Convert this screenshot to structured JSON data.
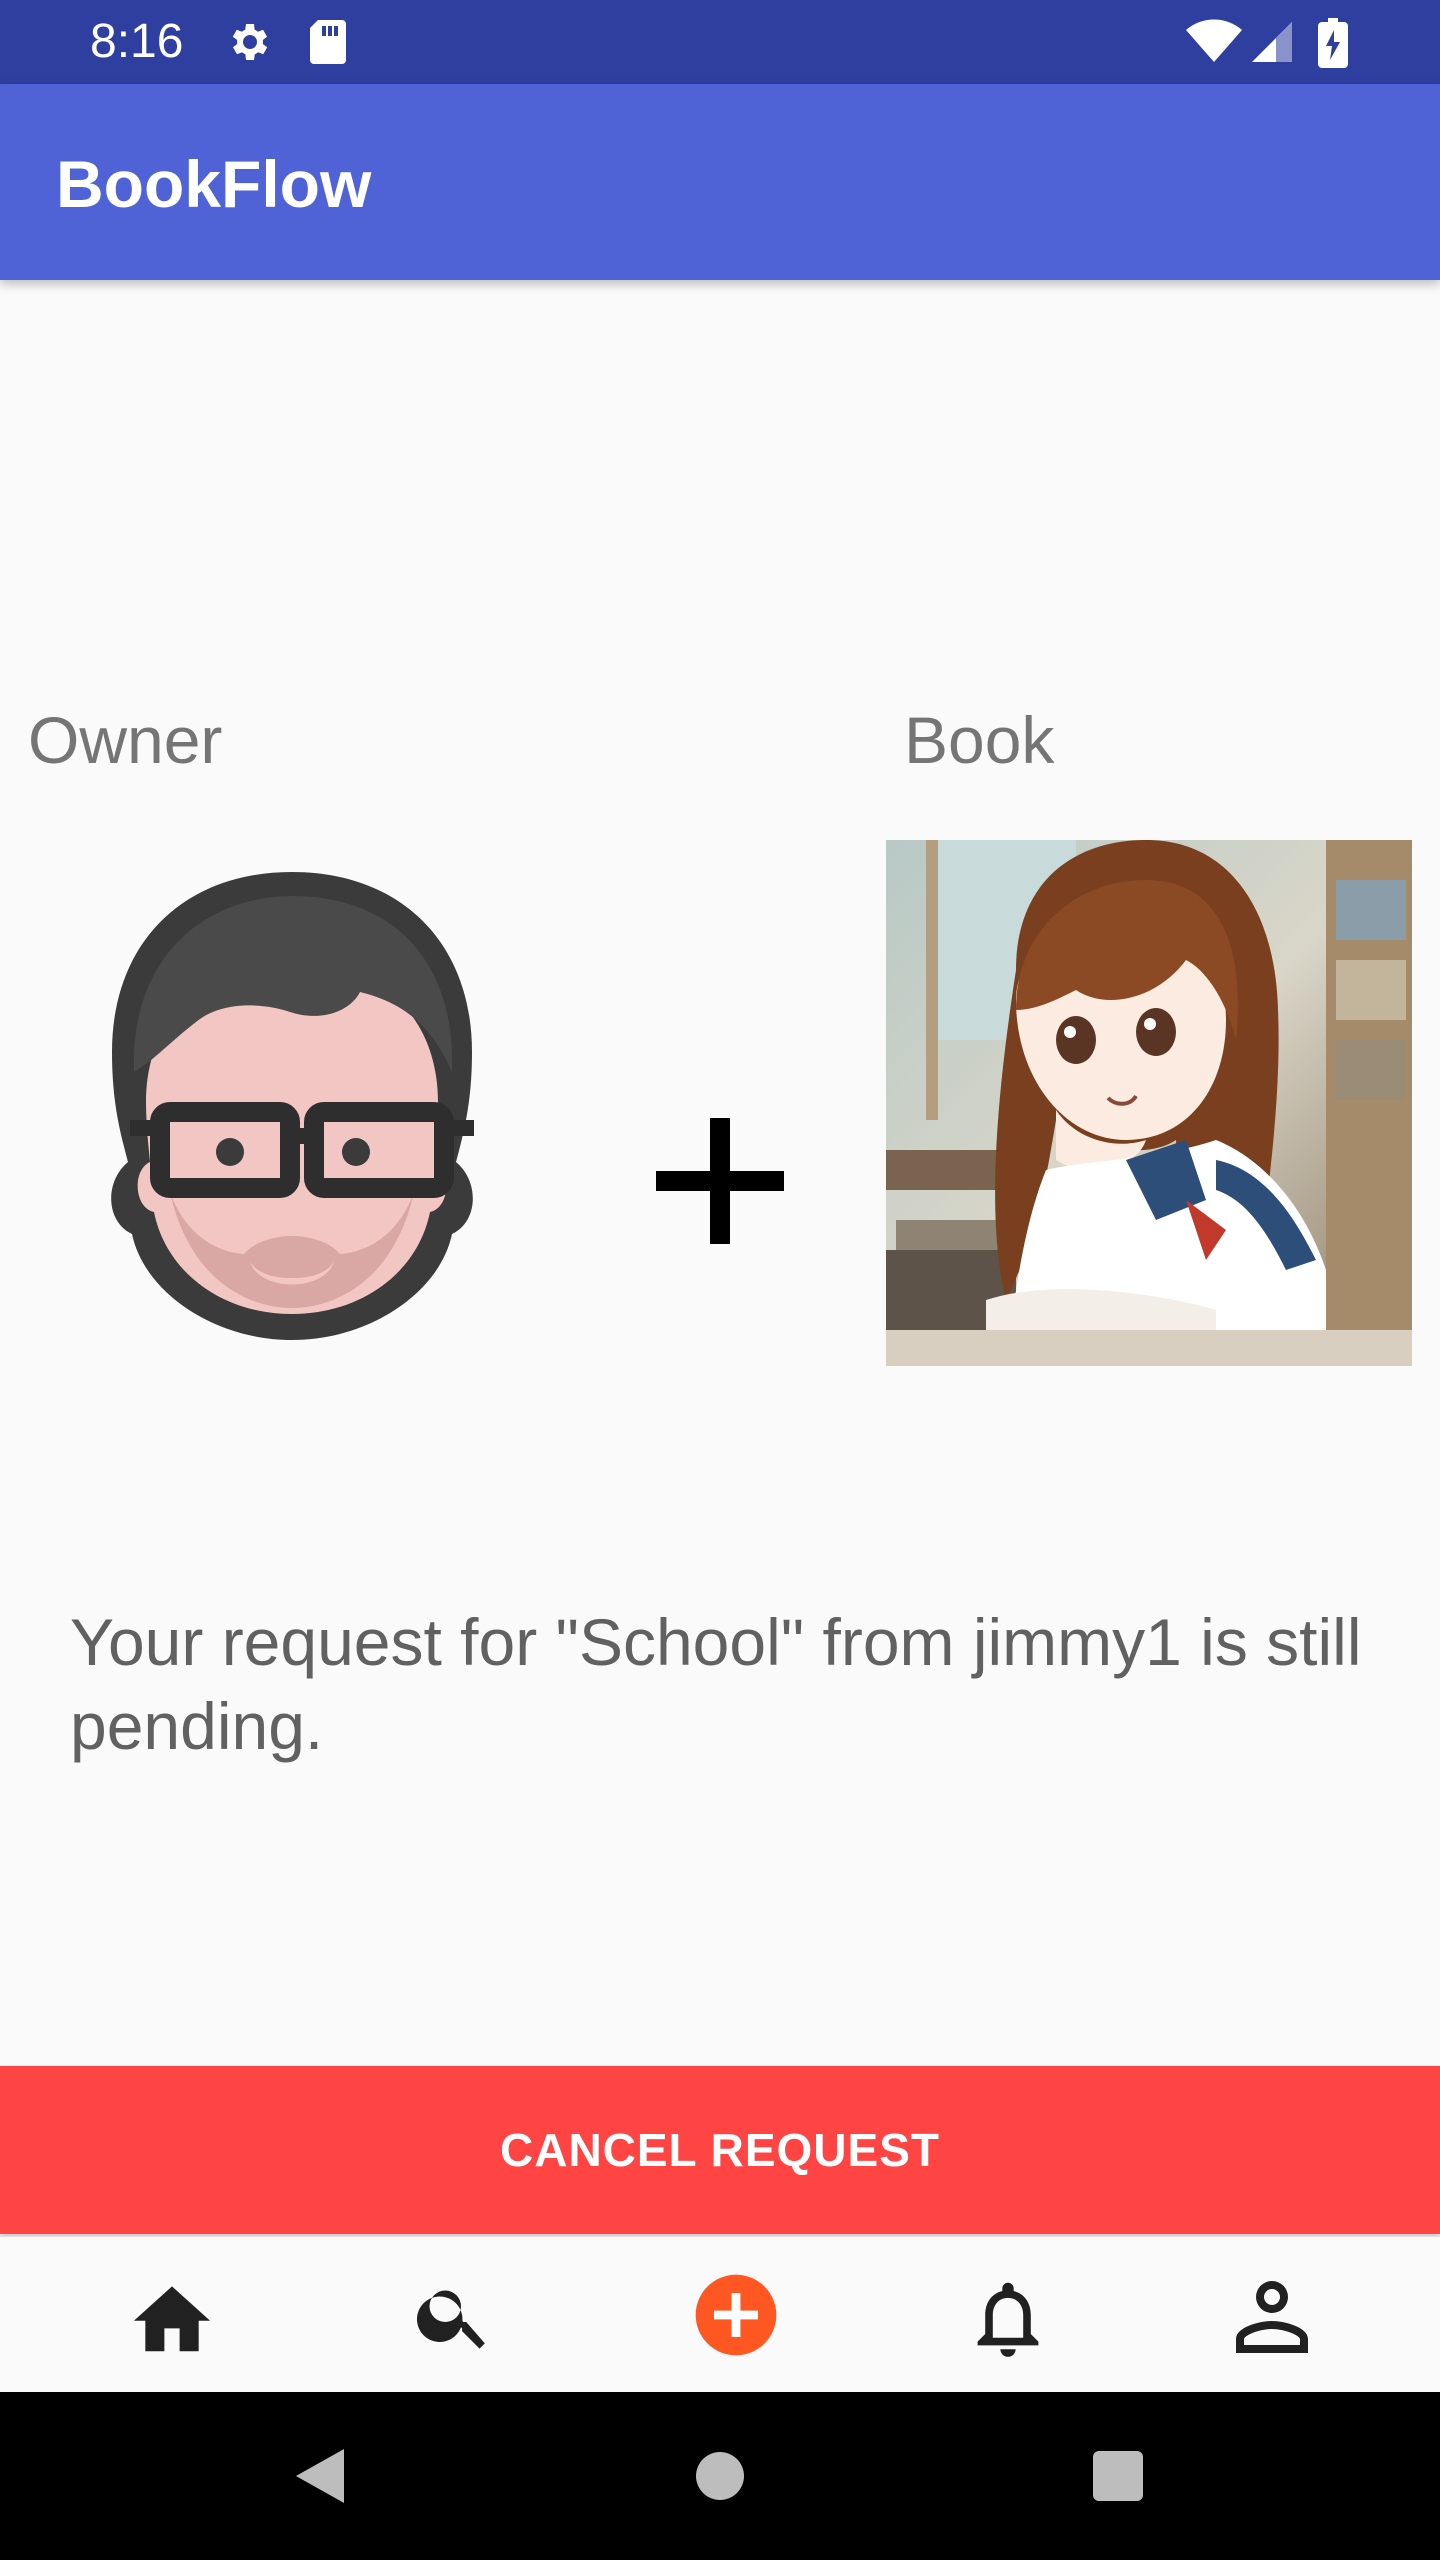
{
  "status_bar": {
    "time": "8:16",
    "icons": [
      "settings-icon",
      "sd-card-icon",
      "wifi-icon",
      "signal-icon",
      "battery-charging-icon"
    ]
  },
  "app_bar": {
    "title": "BookFlow"
  },
  "labels": {
    "owner": "Owner",
    "book": "Book"
  },
  "owner_avatar_icon": "bearded-man-glasses-avatar",
  "plus_icon": "plus-icon",
  "book_cover_icon": "anime-girl-cover-image",
  "message": "Your request for \"School\" from jimmy1 is still pending.",
  "cancel_button": {
    "label": "CANCEL REQUEST",
    "color": "#FF4444"
  },
  "bottom_nav": {
    "items": [
      {
        "icon": "home-icon"
      },
      {
        "icon": "search-icon"
      },
      {
        "icon": "add-circle-icon",
        "active": true,
        "color": "#FF5722"
      },
      {
        "icon": "notifications-icon"
      },
      {
        "icon": "profile-icon"
      }
    ]
  },
  "system_nav": [
    "back-icon",
    "home-circle-icon",
    "recents-icon"
  ],
  "colors": {
    "primary": "#4F63D7",
    "primary_dark": "#2F3FA0",
    "accent": "#FF5722",
    "danger": "#FF4444"
  }
}
